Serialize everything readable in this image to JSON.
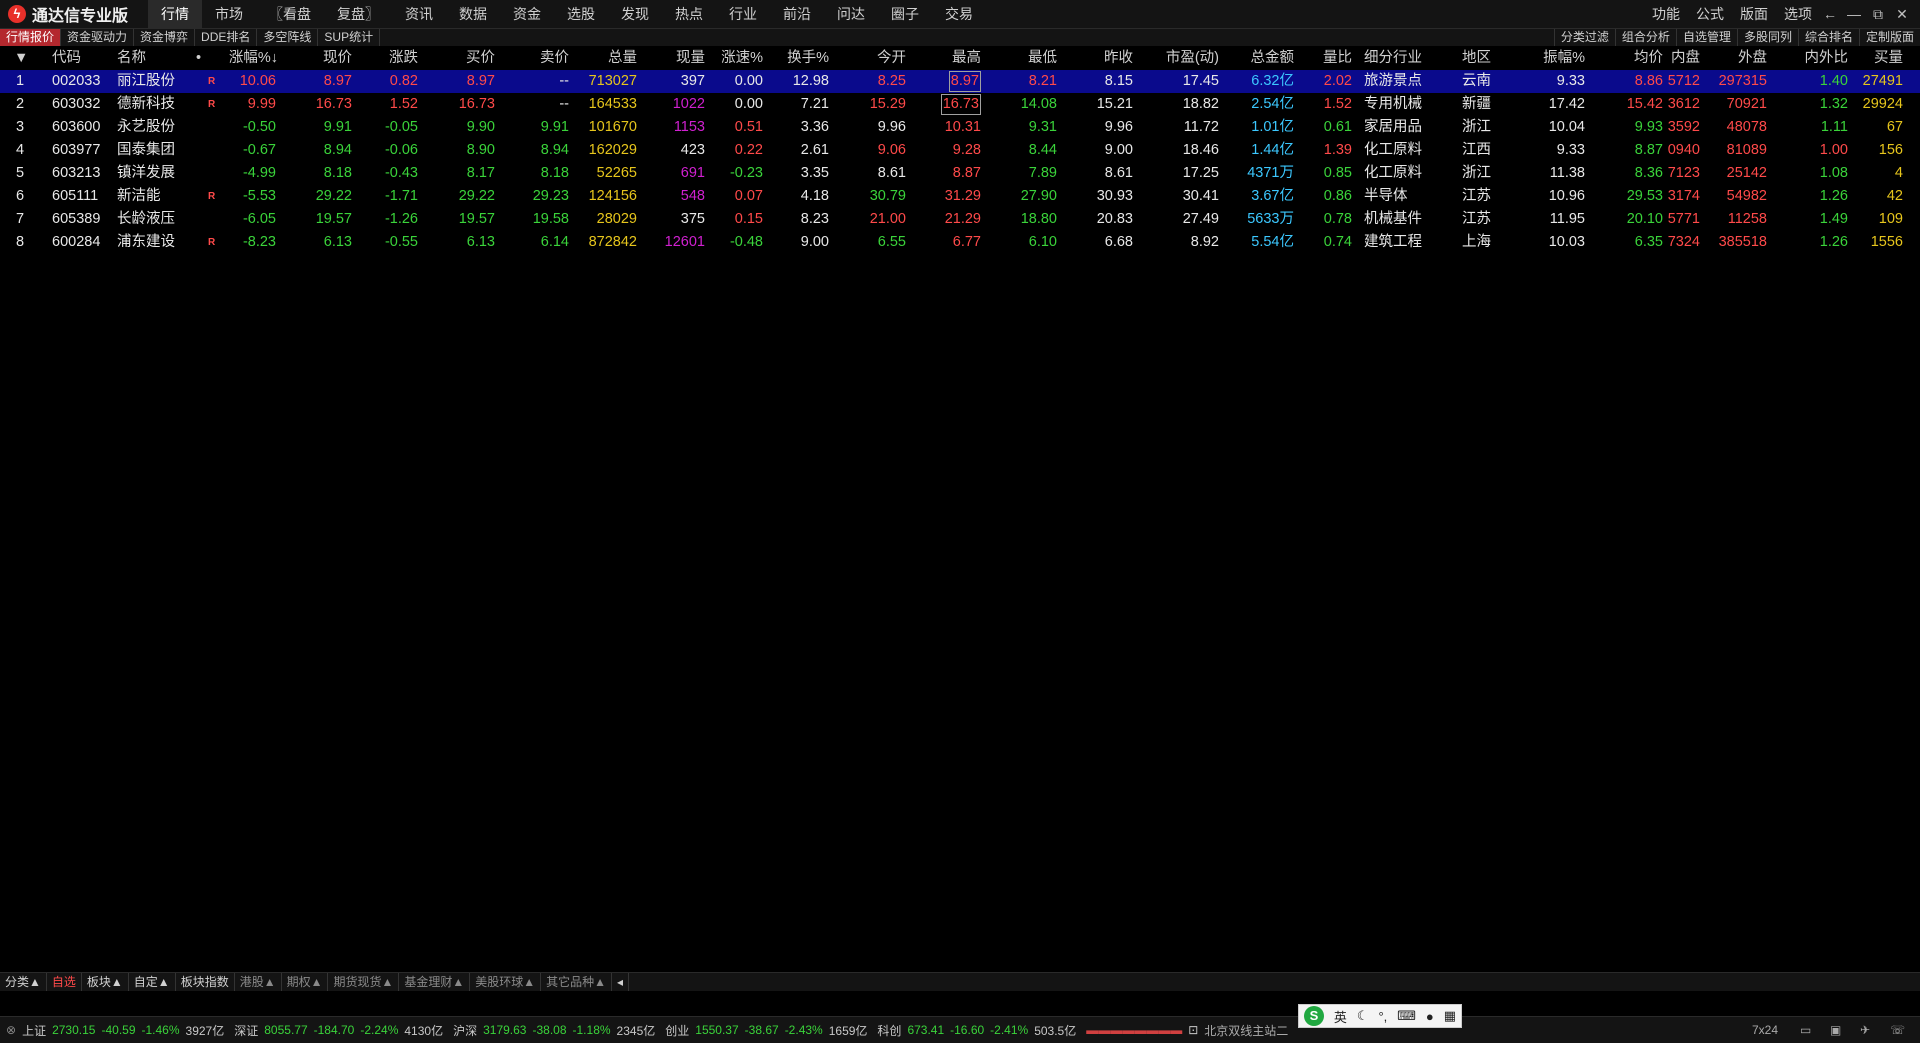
{
  "app": {
    "title": "通达信专业版"
  },
  "menu": [
    "行情",
    "市场",
    "〖看盘",
    "复盘〗",
    "资讯",
    "数据",
    "资金",
    "选股",
    "发现",
    "热点",
    "行业",
    "前沿",
    "问达",
    "圈子",
    "交易"
  ],
  "right_menu": [
    "功能",
    "公式",
    "版面",
    "选项"
  ],
  "window_controls": [
    "←",
    "—",
    "⧉",
    "✕"
  ],
  "subtabs_left": [
    "行情报价",
    "资金驱动力",
    "资金博弈",
    "DDE排名",
    "多空阵线",
    "SUP统计"
  ],
  "subtabs_right": [
    "分类过滤",
    "组合分析",
    "自选管理",
    "多股同列",
    "综合排名",
    "定制版面"
  ],
  "table": {
    "headers": [
      "代码",
      "名称",
      "•",
      "涨幅%↓",
      "现价",
      "涨跌",
      "买价",
      "卖价",
      "总量",
      "现量",
      "涨速%",
      "换手%",
      "今开",
      "最高",
      "最低",
      "昨收",
      "市盈(动)",
      "总金额",
      "量比",
      "细分行业",
      "地区",
      "振幅%",
      "均价",
      "内盘",
      "外盘",
      "内外比",
      "买量"
    ],
    "rows": [
      [
        "1",
        "002033",
        "丽江股份",
        "R",
        "10.06",
        "8.97",
        "0.82",
        "8.97",
        "--",
        "713027",
        "397",
        "0.00",
        "12.98",
        "8.25",
        "8.97",
        "8.21",
        "8.15",
        "17.45",
        "6.32亿",
        "2.02",
        "旅游景点",
        "云南",
        "9.33",
        "8.86",
        "5712",
        "297315",
        "1.40",
        "27491"
      ],
      [
        "2",
        "603032",
        "德新科技",
        "R",
        "9.99",
        "16.73",
        "1.52",
        "16.73",
        "--",
        "164533",
        "1022",
        "0.00",
        "7.21",
        "15.29",
        "16.73",
        "14.08",
        "15.21",
        "18.82",
        "2.54亿",
        "1.52",
        "专用机械",
        "新疆",
        "17.42",
        "15.42",
        "3612",
        "70921",
        "1.32",
        "29924"
      ],
      [
        "3",
        "603600",
        "永艺股份",
        "",
        "-0.50",
        "9.91",
        "-0.05",
        "9.90",
        "9.91",
        "101670",
        "1153",
        "0.51",
        "3.36",
        "9.96",
        "10.31",
        "9.31",
        "9.96",
        "11.72",
        "1.01亿",
        "0.61",
        "家居用品",
        "浙江",
        "10.04",
        "9.93",
        "3592",
        "48078",
        "1.11",
        "67"
      ],
      [
        "4",
        "603977",
        "国泰集团",
        "",
        "-0.67",
        "8.94",
        "-0.06",
        "8.90",
        "8.94",
        "162029",
        "423",
        "0.22",
        "2.61",
        "9.06",
        "9.28",
        "8.44",
        "9.00",
        "18.46",
        "1.44亿",
        "1.39",
        "化工原料",
        "江西",
        "9.33",
        "8.87",
        "0940",
        "81089",
        "1.00",
        "156"
      ],
      [
        "5",
        "603213",
        "镇洋发展",
        "",
        "-4.99",
        "8.18",
        "-0.43",
        "8.17",
        "8.18",
        "52265",
        "691",
        "-0.23",
        "3.35",
        "8.61",
        "8.87",
        "7.89",
        "8.61",
        "17.25",
        "4371万",
        "0.85",
        "化工原料",
        "浙江",
        "11.38",
        "8.36",
        "7123",
        "25142",
        "1.08",
        "4"
      ],
      [
        "6",
        "605111",
        "新洁能",
        "R",
        "-5.53",
        "29.22",
        "-1.71",
        "29.22",
        "29.23",
        "124156",
        "548",
        "0.07",
        "4.18",
        "30.79",
        "31.29",
        "27.90",
        "30.93",
        "30.41",
        "3.67亿",
        "0.86",
        "半导体",
        "江苏",
        "10.96",
        "29.53",
        "3174",
        "54982",
        "1.26",
        "42"
      ],
      [
        "7",
        "605389",
        "长龄液压",
        "",
        "-6.05",
        "19.57",
        "-1.26",
        "19.57",
        "19.58",
        "28029",
        "375",
        "0.15",
        "8.23",
        "21.00",
        "21.29",
        "18.80",
        "20.83",
        "27.49",
        "5633万",
        "0.78",
        "机械基件",
        "江苏",
        "11.95",
        "20.10",
        "5771",
        "11258",
        "1.49",
        "109"
      ],
      [
        "8",
        "600284",
        "浦东建设",
        "R",
        "-8.23",
        "6.13",
        "-0.55",
        "6.13",
        "6.14",
        "872842",
        "12601",
        "-0.48",
        "9.00",
        "6.55",
        "6.77",
        "6.10",
        "6.68",
        "8.92",
        "5.54亿",
        "0.74",
        "建筑工程",
        "上海",
        "10.03",
        "6.35",
        "7324",
        "385518",
        "1.26",
        "1556"
      ]
    ],
    "colors": [
      [
        "white",
        "white",
        "white",
        "red",
        "red",
        "red",
        "red",
        "red",
        "white",
        "yellow",
        "white",
        "white",
        "white",
        "red",
        "red",
        "red",
        "white",
        "white",
        "cyan",
        "red",
        "white",
        "white",
        "white",
        "red",
        "red",
        "red",
        "green",
        "yellow"
      ],
      [
        "white",
        "white",
        "white",
        "red",
        "red",
        "red",
        "red",
        "red",
        "white",
        "yellow",
        "mag",
        "white",
        "white",
        "red",
        "red",
        "green",
        "white",
        "white",
        "cyan",
        "red",
        "white",
        "white",
        "white",
        "red",
        "red",
        "red",
        "green",
        "yellow"
      ],
      [
        "white",
        "white",
        "white",
        "red",
        "green",
        "green",
        "green",
        "green",
        "green",
        "yellow",
        "mag",
        "red",
        "white",
        "white",
        "red",
        "green",
        "white",
        "white",
        "cyan",
        "green",
        "white",
        "white",
        "white",
        "green",
        "red",
        "red",
        "green",
        "yellow"
      ],
      [
        "white",
        "white",
        "white",
        "red",
        "green",
        "green",
        "green",
        "green",
        "green",
        "yellow",
        "white",
        "red",
        "white",
        "red",
        "red",
        "green",
        "white",
        "white",
        "cyan",
        "red",
        "white",
        "white",
        "white",
        "green",
        "red",
        "red",
        "red",
        "yellow"
      ],
      [
        "white",
        "white",
        "white",
        "red",
        "green",
        "green",
        "green",
        "green",
        "green",
        "yellow",
        "mag",
        "green",
        "white",
        "white",
        "red",
        "green",
        "white",
        "white",
        "cyan",
        "green",
        "white",
        "white",
        "white",
        "green",
        "red",
        "red",
        "green",
        "yellow"
      ],
      [
        "white",
        "white",
        "white",
        "red",
        "green",
        "green",
        "green",
        "green",
        "green",
        "yellow",
        "mag",
        "red",
        "white",
        "green",
        "red",
        "green",
        "white",
        "white",
        "cyan",
        "green",
        "white",
        "white",
        "white",
        "green",
        "red",
        "red",
        "green",
        "yellow"
      ],
      [
        "white",
        "white",
        "white",
        "red",
        "green",
        "green",
        "green",
        "green",
        "green",
        "yellow",
        "white",
        "red",
        "white",
        "red",
        "red",
        "green",
        "white",
        "white",
        "cyan",
        "green",
        "white",
        "white",
        "white",
        "green",
        "red",
        "red",
        "green",
        "yellow"
      ],
      [
        "white",
        "white",
        "white",
        "red",
        "green",
        "green",
        "green",
        "green",
        "green",
        "yellow",
        "mag",
        "green",
        "white",
        "green",
        "red",
        "green",
        "white",
        "white",
        "cyan",
        "green",
        "white",
        "white",
        "white",
        "green",
        "red",
        "red",
        "green",
        "yellow"
      ]
    ]
  },
  "bottom_tabs": [
    "分类▲",
    "自选",
    "板块▲",
    "自定▲",
    "板块指数",
    "港股▲",
    "期权▲",
    "期货现货▲",
    "基金理财▲",
    "美股环球▲",
    "其它品种▲"
  ],
  "status_bar": [
    {
      "label": "上证",
      "value": "2730.15",
      "change": "-40.59",
      "pct": "-1.46%",
      "amount": "3927亿"
    },
    {
      "label": "深证",
      "value": "8055.77",
      "change": "-184.70",
      "pct": "-2.24%",
      "amount": "4130亿"
    },
    {
      "label": "沪深",
      "value": "3179.63",
      "change": "-38.08",
      "pct": "-1.18%",
      "amount": "2345亿"
    },
    {
      "label": "创业",
      "value": "1550.37",
      "change": "-38.67",
      "pct": "-2.43%",
      "amount": "1659亿"
    },
    {
      "label": "科创",
      "value": "673.41",
      "change": "-16.60",
      "pct": "-2.41%",
      "amount": "503.5亿"
    }
  ],
  "status_right": {
    "server": "北京双线主站二",
    "mode": "7x24"
  },
  "ime": {
    "logo": "S",
    "lang": "英"
  }
}
